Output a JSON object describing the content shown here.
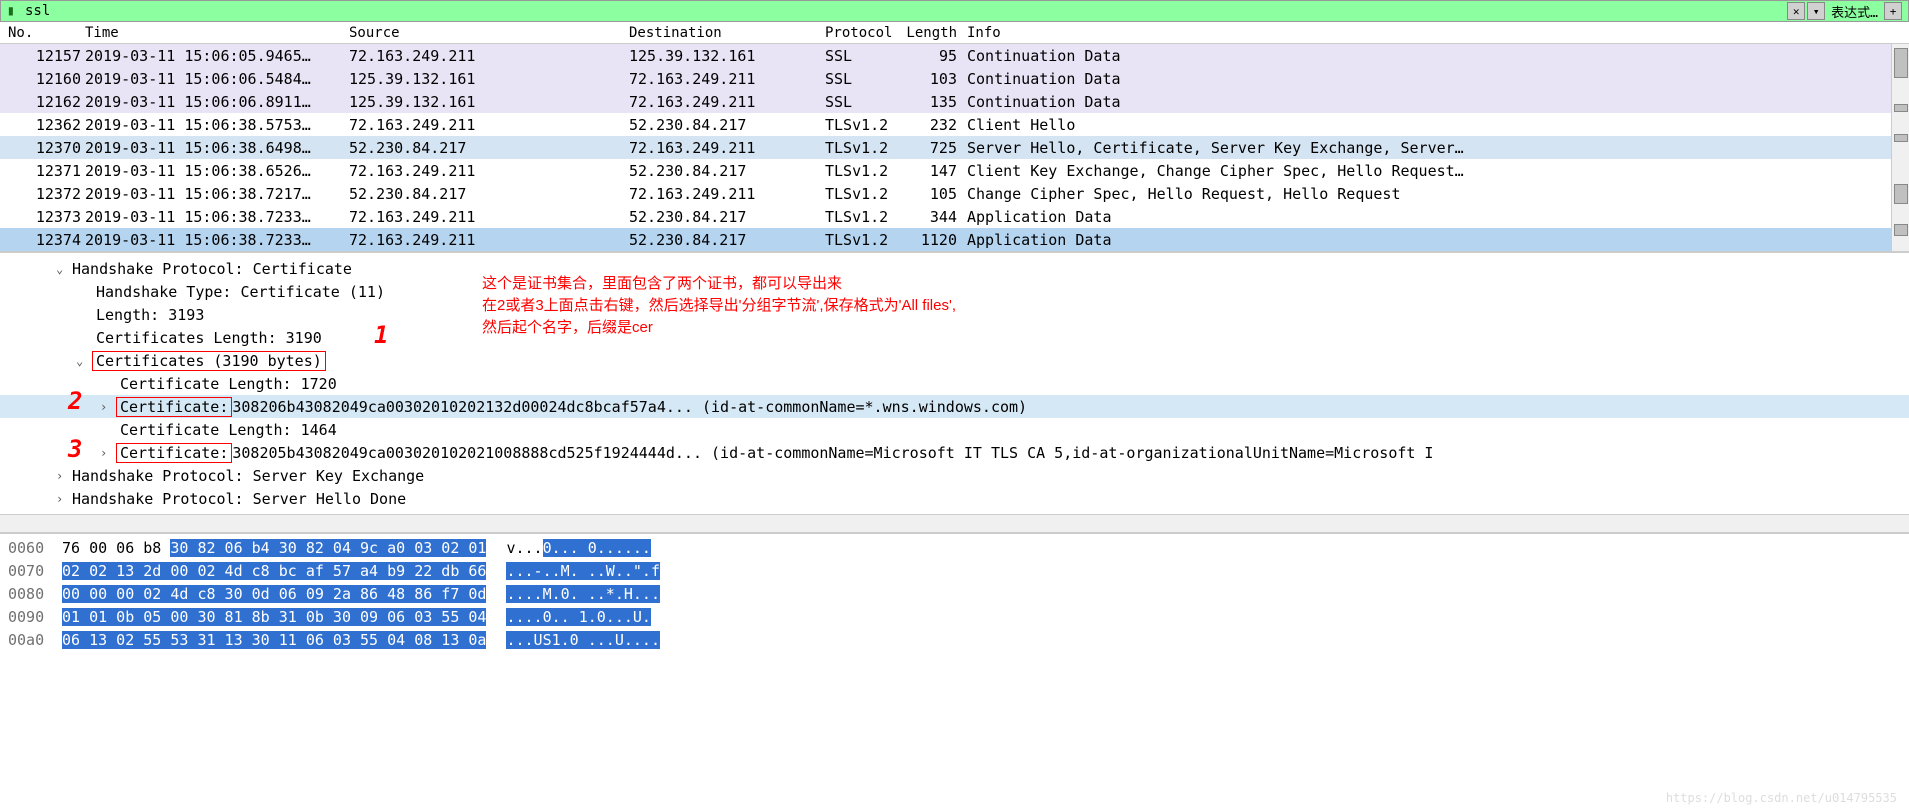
{
  "filter": {
    "value": "ssl",
    "expression_label": "表达式…",
    "close": "✕",
    "dropdown": "▾",
    "plus": "+"
  },
  "columns": {
    "no": "No.",
    "time": "Time",
    "source": "Source",
    "destination": "Destination",
    "protocol": "Protocol",
    "length": "Length",
    "info": "Info"
  },
  "packets": [
    {
      "no": "12157",
      "time": "2019-03-11 15:06:05.9465…",
      "source": "72.163.249.211",
      "dest": "125.39.132.161",
      "proto": "SSL",
      "len": "95",
      "info": "Continuation Data",
      "bg": "bg-lavender"
    },
    {
      "no": "12160",
      "time": "2019-03-11 15:06:06.5484…",
      "source": "125.39.132.161",
      "dest": "72.163.249.211",
      "proto": "SSL",
      "len": "103",
      "info": "Continuation Data",
      "bg": "bg-lavender"
    },
    {
      "no": "12162",
      "time": "2019-03-11 15:06:06.8911…",
      "source": "125.39.132.161",
      "dest": "72.163.249.211",
      "proto": "SSL",
      "len": "135",
      "info": "Continuation Data",
      "bg": "bg-lavender"
    },
    {
      "no": "12362",
      "time": "2019-03-11 15:06:38.5753…",
      "source": "72.163.249.211",
      "dest": "52.230.84.217",
      "proto": "TLSv1.2",
      "len": "232",
      "info": "Client Hello",
      "bg": "bg-white"
    },
    {
      "no": "12370",
      "time": "2019-03-11 15:06:38.6498…",
      "source": "52.230.84.217",
      "dest": "72.163.249.211",
      "proto": "TLSv1.2",
      "len": "725",
      "info": "Server Hello, Certificate, Server Key Exchange, Server…",
      "bg": "bg-grayblue"
    },
    {
      "no": "12371",
      "time": "2019-03-11 15:06:38.6526…",
      "source": "72.163.249.211",
      "dest": "52.230.84.217",
      "proto": "TLSv1.2",
      "len": "147",
      "info": "Client Key Exchange, Change Cipher Spec, Hello Request…",
      "bg": "bg-white"
    },
    {
      "no": "12372",
      "time": "2019-03-11 15:06:38.7217…",
      "source": "52.230.84.217",
      "dest": "72.163.249.211",
      "proto": "TLSv1.2",
      "len": "105",
      "info": "Change Cipher Spec, Hello Request, Hello Request",
      "bg": "bg-white"
    },
    {
      "no": "12373",
      "time": "2019-03-11 15:06:38.7233…",
      "source": "72.163.249.211",
      "dest": "52.230.84.217",
      "proto": "TLSv1.2",
      "len": "344",
      "info": "Application Data",
      "bg": "bg-white"
    },
    {
      "no": "12374",
      "time": "2019-03-11 15:06:38.7233…",
      "source": "72.163.249.211",
      "dest": "52.230.84.217",
      "proto": "TLSv1.2",
      "len": "1120",
      "info": "Application Data",
      "bg": "bg-selected"
    }
  ],
  "tree": {
    "l0": "Handshake Protocol: Certificate",
    "l1": "Handshake Type: Certificate (11)",
    "l2": "Length: 3193",
    "l3": "Certificates Length: 3190",
    "l4": "Certificates (3190 bytes)",
    "l5": "Certificate Length: 1720",
    "l6a": "Certificate:",
    "l6b": " 308206b43082049ca00302010202132d00024dc8bcaf57a4... (id-at-commonName=*.wns.windows.com)",
    "l7": "Certificate Length: 1464",
    "l8a": "Certificate:",
    "l8b": " 308205b43082049ca003020102021008888cd525f1924444d... (id-at-commonName=Microsoft IT TLS CA 5,id-at-organizationalUnitName=Microsoft I",
    "l9": "Handshake Protocol: Server Key Exchange",
    "l10": "Handshake Protocol: Server Hello Done"
  },
  "annotation": {
    "line1": "这个是证书集合，里面包含了两个证书，都可以导出来",
    "line2": "在2或者3上面点击右键，然后选择导出'分组字节流',保存格式为'All files',",
    "line3": "然后起个名字，后缀是cer",
    "num1": "1",
    "num2": "2",
    "num3": "3"
  },
  "bytes": [
    {
      "offset": "0060",
      "pre": "76 00 06 b8 ",
      "hex": "30 82 06 b4  30 82 04 9c a0 03 02 01",
      "apre": "v...",
      "asel": "0... 0......"
    },
    {
      "offset": "0070",
      "pre": "",
      "hex": "02 02 13 2d 00 02 4d c8  bc af 57 a4 b9 22 db 66",
      "apre": "",
      "asel": "...-..M. ..W..\".f"
    },
    {
      "offset": "0080",
      "pre": "",
      "hex": "00 00 00 02 4d c8 30 0d  06 09 2a 86 48 86 f7 0d",
      "apre": "",
      "asel": "....M.0. ..*.H..."
    },
    {
      "offset": "0090",
      "pre": "",
      "hex": "01 01 0b 05 00 30 81 8b  31 0b 30 09 06 03 55 04",
      "apre": "",
      "asel": "....0.. 1.0...U."
    },
    {
      "offset": "00a0",
      "pre": "",
      "hex": "06 13 02 55 53 31 13 30  11 06 03 55 04 08 13 0a",
      "apre": "",
      "asel": "...US1.0 ...U...."
    }
  ]
}
